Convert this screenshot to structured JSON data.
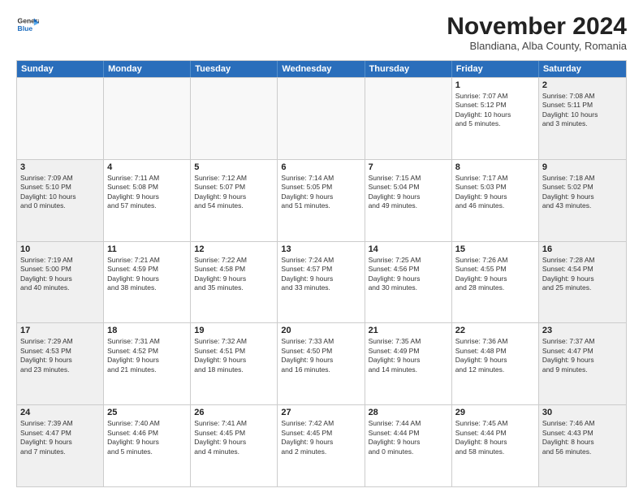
{
  "logo": {
    "general": "General",
    "blue": "Blue"
  },
  "title": "November 2024",
  "location": "Blandiana, Alba County, Romania",
  "days_of_week": [
    "Sunday",
    "Monday",
    "Tuesday",
    "Wednesday",
    "Thursday",
    "Friday",
    "Saturday"
  ],
  "weeks": [
    [
      {
        "day": "",
        "empty": true
      },
      {
        "day": "",
        "empty": true
      },
      {
        "day": "",
        "empty": true
      },
      {
        "day": "",
        "empty": true
      },
      {
        "day": "",
        "empty": true
      },
      {
        "day": "1",
        "info": "Sunrise: 7:07 AM\nSunset: 5:12 PM\nDaylight: 10 hours\nand 5 minutes."
      },
      {
        "day": "2",
        "info": "Sunrise: 7:08 AM\nSunset: 5:11 PM\nDaylight: 10 hours\nand 3 minutes."
      }
    ],
    [
      {
        "day": "3",
        "info": "Sunrise: 7:09 AM\nSunset: 5:10 PM\nDaylight: 10 hours\nand 0 minutes."
      },
      {
        "day": "4",
        "info": "Sunrise: 7:11 AM\nSunset: 5:08 PM\nDaylight: 9 hours\nand 57 minutes."
      },
      {
        "day": "5",
        "info": "Sunrise: 7:12 AM\nSunset: 5:07 PM\nDaylight: 9 hours\nand 54 minutes."
      },
      {
        "day": "6",
        "info": "Sunrise: 7:14 AM\nSunset: 5:05 PM\nDaylight: 9 hours\nand 51 minutes."
      },
      {
        "day": "7",
        "info": "Sunrise: 7:15 AM\nSunset: 5:04 PM\nDaylight: 9 hours\nand 49 minutes."
      },
      {
        "day": "8",
        "info": "Sunrise: 7:17 AM\nSunset: 5:03 PM\nDaylight: 9 hours\nand 46 minutes."
      },
      {
        "day": "9",
        "info": "Sunrise: 7:18 AM\nSunset: 5:02 PM\nDaylight: 9 hours\nand 43 minutes."
      }
    ],
    [
      {
        "day": "10",
        "info": "Sunrise: 7:19 AM\nSunset: 5:00 PM\nDaylight: 9 hours\nand 40 minutes."
      },
      {
        "day": "11",
        "info": "Sunrise: 7:21 AM\nSunset: 4:59 PM\nDaylight: 9 hours\nand 38 minutes."
      },
      {
        "day": "12",
        "info": "Sunrise: 7:22 AM\nSunset: 4:58 PM\nDaylight: 9 hours\nand 35 minutes."
      },
      {
        "day": "13",
        "info": "Sunrise: 7:24 AM\nSunset: 4:57 PM\nDaylight: 9 hours\nand 33 minutes."
      },
      {
        "day": "14",
        "info": "Sunrise: 7:25 AM\nSunset: 4:56 PM\nDaylight: 9 hours\nand 30 minutes."
      },
      {
        "day": "15",
        "info": "Sunrise: 7:26 AM\nSunset: 4:55 PM\nDaylight: 9 hours\nand 28 minutes."
      },
      {
        "day": "16",
        "info": "Sunrise: 7:28 AM\nSunset: 4:54 PM\nDaylight: 9 hours\nand 25 minutes."
      }
    ],
    [
      {
        "day": "17",
        "info": "Sunrise: 7:29 AM\nSunset: 4:53 PM\nDaylight: 9 hours\nand 23 minutes."
      },
      {
        "day": "18",
        "info": "Sunrise: 7:31 AM\nSunset: 4:52 PM\nDaylight: 9 hours\nand 21 minutes."
      },
      {
        "day": "19",
        "info": "Sunrise: 7:32 AM\nSunset: 4:51 PM\nDaylight: 9 hours\nand 18 minutes."
      },
      {
        "day": "20",
        "info": "Sunrise: 7:33 AM\nSunset: 4:50 PM\nDaylight: 9 hours\nand 16 minutes."
      },
      {
        "day": "21",
        "info": "Sunrise: 7:35 AM\nSunset: 4:49 PM\nDaylight: 9 hours\nand 14 minutes."
      },
      {
        "day": "22",
        "info": "Sunrise: 7:36 AM\nSunset: 4:48 PM\nDaylight: 9 hours\nand 12 minutes."
      },
      {
        "day": "23",
        "info": "Sunrise: 7:37 AM\nSunset: 4:47 PM\nDaylight: 9 hours\nand 9 minutes."
      }
    ],
    [
      {
        "day": "24",
        "info": "Sunrise: 7:39 AM\nSunset: 4:47 PM\nDaylight: 9 hours\nand 7 minutes."
      },
      {
        "day": "25",
        "info": "Sunrise: 7:40 AM\nSunset: 4:46 PM\nDaylight: 9 hours\nand 5 minutes."
      },
      {
        "day": "26",
        "info": "Sunrise: 7:41 AM\nSunset: 4:45 PM\nDaylight: 9 hours\nand 4 minutes."
      },
      {
        "day": "27",
        "info": "Sunrise: 7:42 AM\nSunset: 4:45 PM\nDaylight: 9 hours\nand 2 minutes."
      },
      {
        "day": "28",
        "info": "Sunrise: 7:44 AM\nSunset: 4:44 PM\nDaylight: 9 hours\nand 0 minutes."
      },
      {
        "day": "29",
        "info": "Sunrise: 7:45 AM\nSunset: 4:44 PM\nDaylight: 8 hours\nand 58 minutes."
      },
      {
        "day": "30",
        "info": "Sunrise: 7:46 AM\nSunset: 4:43 PM\nDaylight: 8 hours\nand 56 minutes."
      }
    ]
  ]
}
